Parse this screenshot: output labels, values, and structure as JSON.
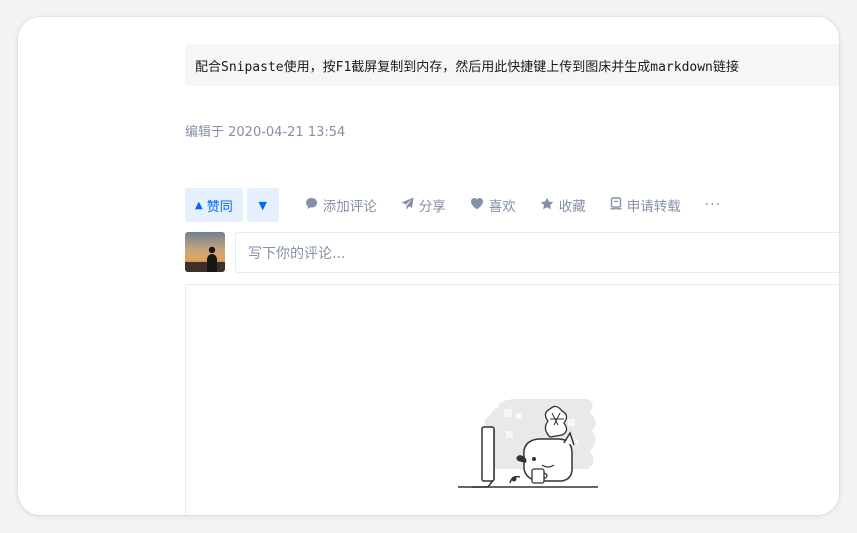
{
  "answer": {
    "code_text": "配合Snipaste使用，按F1截屏复制到内存，然后用此快捷键上传到图床并生成markdown链接",
    "edit_time": "编辑于 2020-04-21 13:54"
  },
  "actions": {
    "vote_up_label": "赞同",
    "vote_up_icon": "▲",
    "vote_down_icon": "▼",
    "comment_label": "添加评论",
    "share_label": "分享",
    "like_label": "喜欢",
    "favorite_label": "收藏",
    "reprint_label": "申请转载",
    "more_label": "···"
  },
  "comment": {
    "placeholder": "写下你的评论..."
  },
  "colors": {
    "accent": "#0066ff",
    "vote_bg": "#e5effd",
    "muted_text": "#8590a6"
  },
  "icons": {
    "comment": "comment-bubble-icon",
    "share": "paper-plane-icon",
    "like": "heart-icon",
    "favorite": "star-icon",
    "reprint": "print-icon"
  }
}
